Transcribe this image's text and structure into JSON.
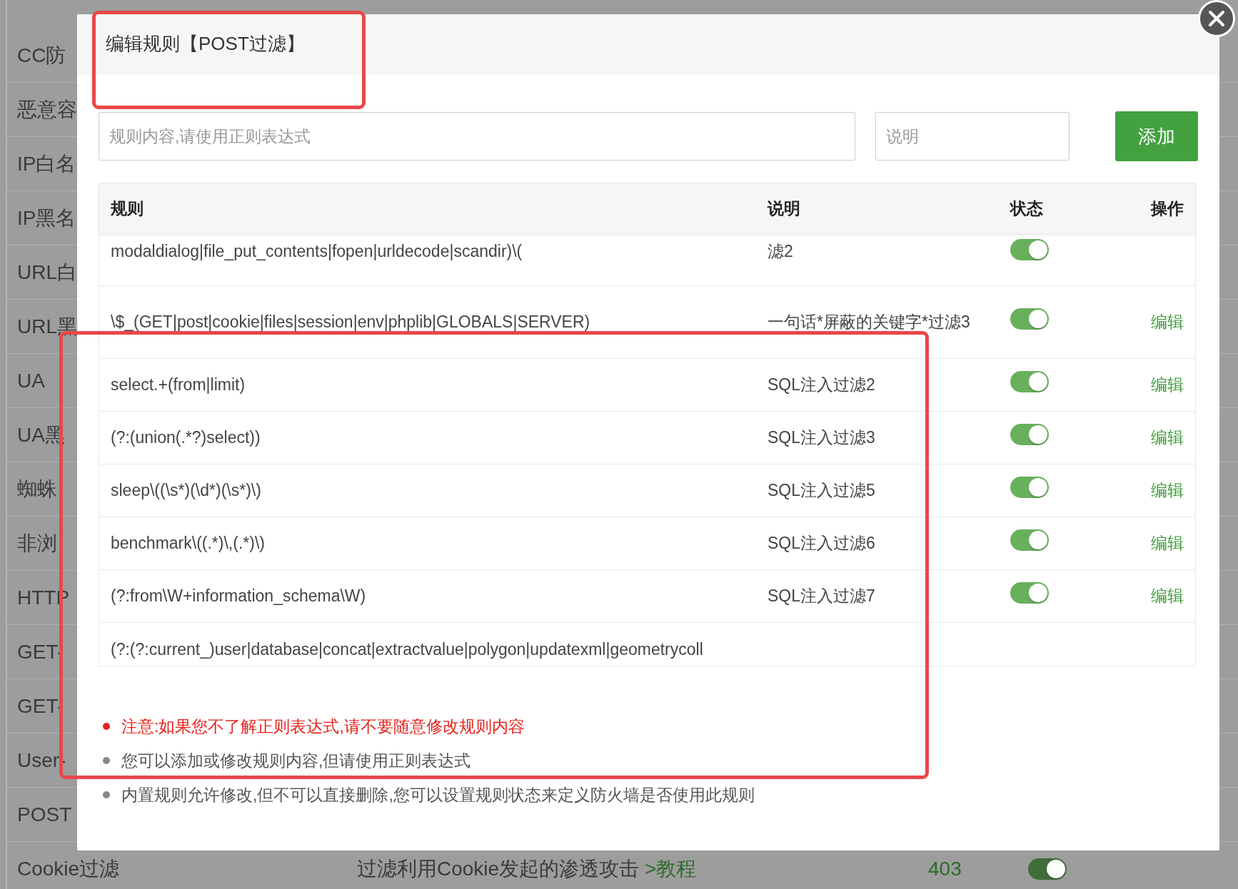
{
  "background": {
    "rows": [
      {
        "label": "CC防"
      },
      {
        "label": "恶意容"
      },
      {
        "label": "IP白名"
      },
      {
        "label": "IP黑名"
      },
      {
        "label": "URL白"
      },
      {
        "label": "URL黑"
      },
      {
        "label": "UA"
      },
      {
        "label": "UA黑"
      },
      {
        "label": "蜘蛛"
      },
      {
        "label": "非浏"
      },
      {
        "label": "HTTP"
      },
      {
        "label": "GET-"
      },
      {
        "label": "GET-"
      },
      {
        "label": "User-"
      },
      {
        "label": "POST"
      },
      {
        "label": "Cookie过滤",
        "description": "过滤利用Cookie发起的渗透攻击",
        "link": ">教程",
        "code": "403",
        "on": true
      }
    ]
  },
  "dialog": {
    "title": "编辑规则【POST过滤】",
    "rule_field": {
      "placeholder": "规则内容,请使用正则表达式"
    },
    "note_field": {
      "placeholder": "说明"
    },
    "add_button": "添加",
    "table": {
      "columns": [
        "规则",
        "说明",
        "状态",
        "操作"
      ],
      "rows": [
        {
          "rule": "modaldialog|file_put_contents|fopen|urldecode|scandir)\\(",
          "note": "滤2",
          "on": true
        },
        {
          "rule": "\\$_(GET|post|cookie|files|session|env|phplib|GLOBALS|SERVER)",
          "note": "一句话*屏蔽的关键字*过滤3",
          "on": true,
          "action": "编辑"
        },
        {
          "rule": "select.+(from|limit)",
          "note": "SQL注入过滤2",
          "on": true,
          "action": "编辑"
        },
        {
          "rule": "(?:(union(.*?)select))",
          "note": "SQL注入过滤3",
          "on": true,
          "action": "编辑"
        },
        {
          "rule": "sleep\\((\\s*)(\\d*)(\\s*)\\)",
          "note": "SQL注入过滤5",
          "on": true,
          "action": "编辑"
        },
        {
          "rule": "benchmark\\((.*)\\,(.*)\\)",
          "note": "SQL注入过滤6",
          "on": true,
          "action": "编辑"
        },
        {
          "rule": "(?:from\\W+information_schema\\W)",
          "note": "SQL注入过滤7",
          "on": true,
          "action": "编辑"
        },
        {
          "rule": "(?:(?:current_)user|database|concat|extractvalue|polygon|updatexml|geometrycoll"
        }
      ]
    },
    "notes": [
      {
        "kind": "warning",
        "text": "注意:如果您不了解正则表达式,请不要随意修改规则内容"
      },
      {
        "kind": "info",
        "text": "您可以添加或修改规则内容,但请使用正则表达式"
      },
      {
        "kind": "info",
        "text": "内置规则允许修改,但不可以直接删除,您可以设置规则状态来定义防火墙是否使用此规则"
      }
    ]
  }
}
